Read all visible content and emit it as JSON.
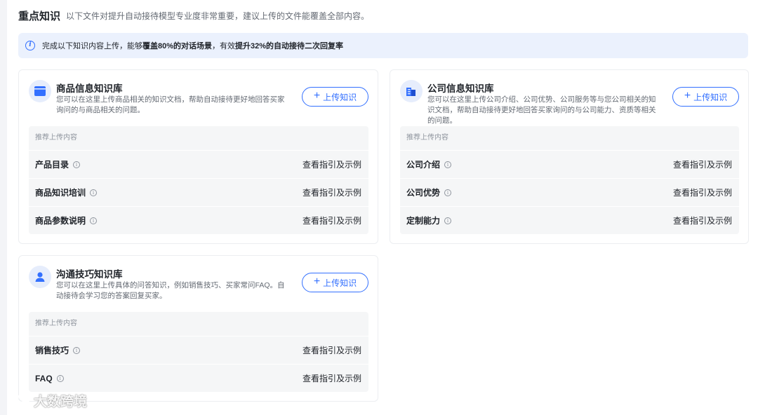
{
  "header": {
    "title": "重点知识",
    "desc": "以下文件对提升自动接待模型专业度非常重要，建议上传的文件能覆盖全部内容。"
  },
  "notice": {
    "text_prefix": "完成以下知识内容上传，能够",
    "bold1": "覆盖80%的对话场景",
    "text_mid": "，有效",
    "bold2": "提升32%的自动接待二次回复率"
  },
  "upload_label": "上传知识",
  "link_label": "查看指引及示例",
  "rec_header": "推荐上传内容",
  "cards": [
    {
      "title": "商品信息知识库",
      "desc": "您可以在这里上传商品相关的知识文档，帮助自动接待更好地回答买家询问的与商品相关的问题。",
      "icon": "box-icon",
      "items": [
        "产品目录",
        "商品知识培训",
        "商品参数说明"
      ]
    },
    {
      "title": "公司信息知识库",
      "desc": "您可以在这里上传公司介绍、公司优势、公司服务等与您公司相关的知识文档，帮助自动接待更好地回答买家询问的与公司能力、资质等相关的问题。",
      "icon": "building-icon",
      "items": [
        "公司介绍",
        "公司优势",
        "定制能力"
      ]
    },
    {
      "title": "沟通技巧知识库",
      "desc": "您可以在这里上传具体的问答知识，例如销售技巧、买家常问FAQ。自动接待会学习您的答案回复买家。",
      "icon": "agent-icon",
      "items": [
        "销售技巧",
        "FAQ"
      ]
    }
  ],
  "watermark": "大数跨境",
  "colors": {
    "accent": "#3370ff",
    "notice_bg": "#ebf1fd",
    "rec_bg": "#f5f6f7"
  }
}
